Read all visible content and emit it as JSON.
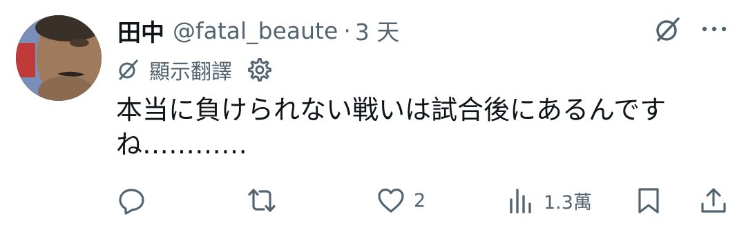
{
  "tweet": {
    "display_name": "田中",
    "handle": "@fatal_beaute",
    "separator": "·",
    "time": "3 天",
    "translate_label": "顯示翻譯",
    "text": "本当に負けられない戦いは試合後にあるんですね…………"
  },
  "actions": {
    "reply": {
      "icon": "reply-icon",
      "count": ""
    },
    "retweet": {
      "icon": "retweet-icon",
      "count": ""
    },
    "like": {
      "icon": "heart-icon",
      "count": "2"
    },
    "views": {
      "icon": "analytics-icon",
      "count": "1.3萬"
    },
    "bookmark": {
      "icon": "bookmark-icon"
    },
    "share": {
      "icon": "share-icon"
    }
  },
  "colors": {
    "text_primary": "#0f1419",
    "text_secondary": "#536471",
    "background": "#ffffff"
  }
}
